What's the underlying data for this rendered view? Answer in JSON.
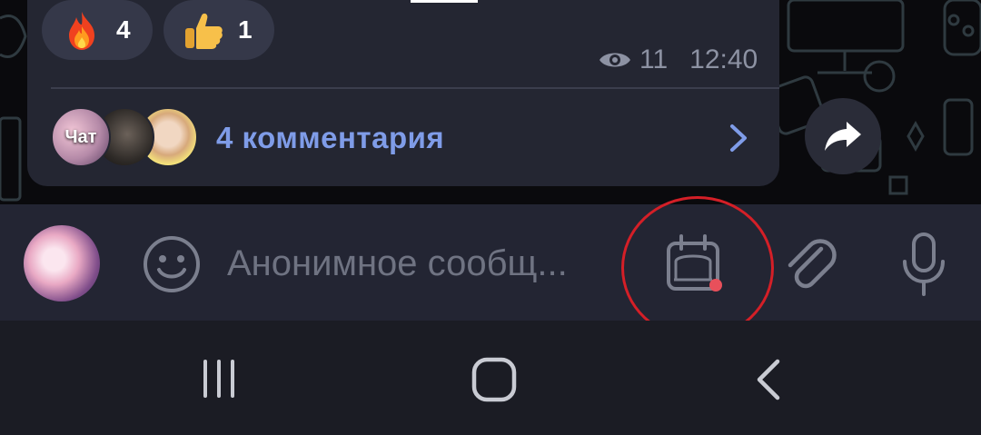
{
  "message": {
    "reactions": [
      {
        "emoji": "fire-emoji",
        "count": "4"
      },
      {
        "emoji": "thumbs-up-emoji",
        "count": "1"
      }
    ],
    "views": "11",
    "time": "12:40",
    "comments_label": "4 комментария",
    "avatar_chat_label": "Чат"
  },
  "input": {
    "placeholder": "Анонимное сообщ..."
  },
  "colors": {
    "bubble": "#242632",
    "accent_link": "#7f9ce8",
    "input_bar": "#232533",
    "highlight_circle": "#d41f27"
  },
  "icons": {
    "views": "eye-icon",
    "comments_arrow": "chevron-right-icon",
    "share": "share-arrow-icon",
    "emoji": "smiley-icon",
    "schedule": "scheduled-message-icon",
    "attach": "paperclip-icon",
    "mic": "microphone-icon",
    "nav_recent": "recent-apps-icon",
    "nav_home": "home-icon",
    "nav_back": "back-icon"
  }
}
